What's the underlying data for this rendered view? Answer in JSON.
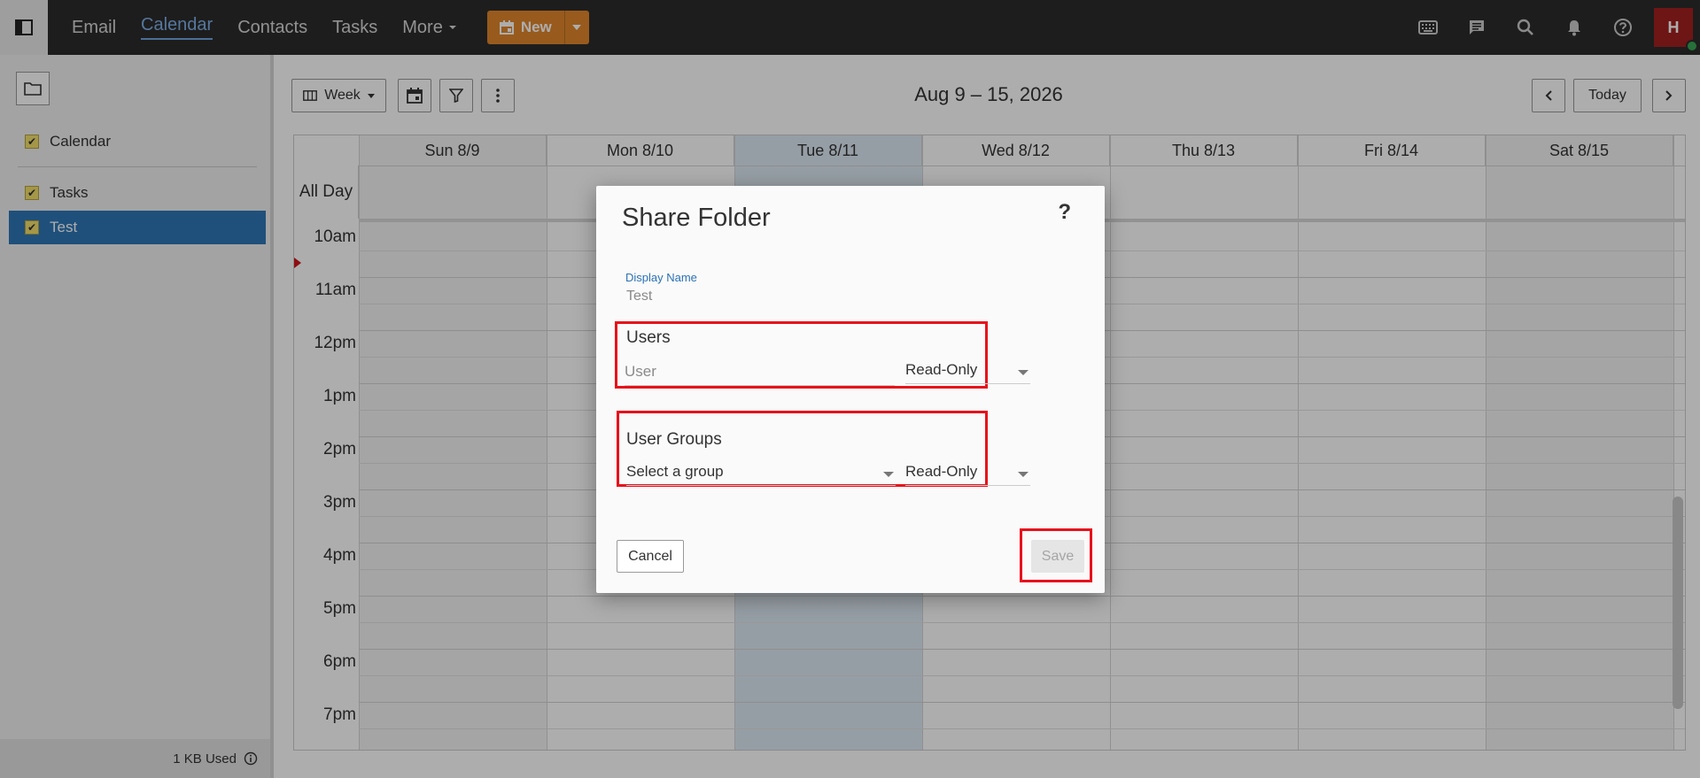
{
  "nav": {
    "items": [
      {
        "label": "Email",
        "active": false
      },
      {
        "label": "Calendar",
        "active": true
      },
      {
        "label": "Contacts",
        "active": false
      },
      {
        "label": "Tasks",
        "active": false
      },
      {
        "label": "More",
        "active": false
      }
    ],
    "new_label": "New"
  },
  "user": {
    "initial": "H"
  },
  "sidebar": {
    "calendars": [
      {
        "label": "Calendar",
        "checked": true,
        "selected": false
      },
      {
        "label": "Tasks",
        "checked": true,
        "selected": false
      },
      {
        "label": "Test",
        "checked": true,
        "selected": true
      }
    ],
    "quota": "1 KB Used"
  },
  "toolbar": {
    "view_label": "Week",
    "date_range": "Aug 9 – 15, 2026",
    "today_label": "Today"
  },
  "calendar": {
    "days": [
      "Sun 8/9",
      "Mon 8/10",
      "Tue 8/11",
      "Wed 8/12",
      "Thu 8/13",
      "Fri 8/14",
      "Sat 8/15"
    ],
    "today_index": 2,
    "allday_label": "All Day",
    "hours": [
      "10am",
      "11am",
      "12pm",
      "1pm",
      "2pm",
      "3pm",
      "4pm",
      "5pm",
      "6pm",
      "7pm"
    ]
  },
  "dialog": {
    "title": "Share Folder",
    "help": "?",
    "display_name_label": "Display Name",
    "display_name_value": "Test",
    "users_title": "Users",
    "user_placeholder": "User",
    "user_permission": "Read-Only",
    "groups_title": "User Groups",
    "group_placeholder": "Select a group",
    "group_permission": "Read-Only",
    "cancel_label": "Cancel",
    "save_label": "Save"
  },
  "colors": {
    "topbar": "#2b2b2b",
    "accent_new": "#e1862b",
    "selection": "#2e76b5",
    "today_column": "#dde9f4",
    "highlight": "#e8101a",
    "avatar": "#a21f1f"
  }
}
